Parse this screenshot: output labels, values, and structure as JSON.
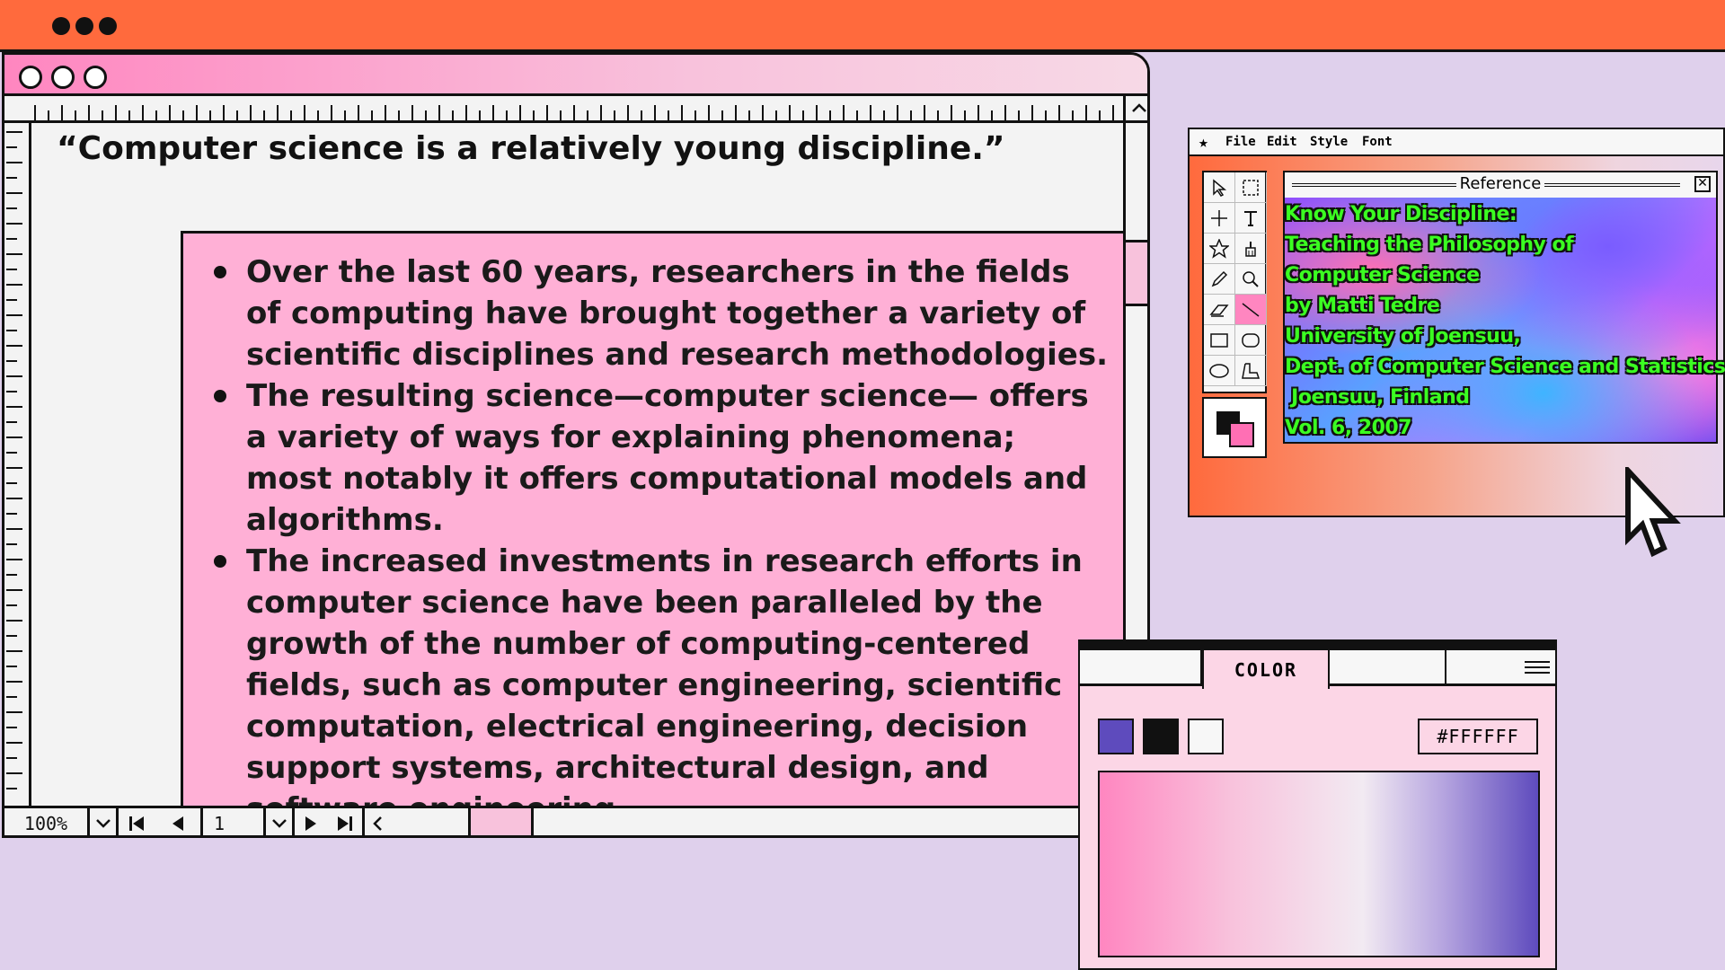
{
  "top_bar": {
    "dots": 3
  },
  "editor": {
    "quote": "“Computer science is a relatively young discipline.”",
    "bullets": [
      "Over the last 60 years, researchers in the fields of computing have brought together a variety of scientific disciplines and research methodologies.",
      "The resulting science—computer science— offers a variety of ways for explaining phenomena; most notably it offers computational models and algorithms.",
      "The increased investments in research efforts in computer science have been paralleled by the growth of the number of computing-centered fields, such as computer engineering, scientific computation, electrical engineering, decision support systems, architectural design, and software engineering."
    ],
    "status": {
      "zoom": "100%",
      "page": "1"
    }
  },
  "paint": {
    "menu": [
      "File",
      "Edit",
      "Style",
      "Font"
    ],
    "reference_title": "Reference",
    "reference_lines": [
      "Know Your Discipline:",
      "Teaching the Philosophy of",
      "Computer Science",
      "by Matti Tedre",
      "University of Joensuu,",
      "Dept. of Computer Science and Statistics",
      " Joensuu, Finland",
      "Vol. 6, 2007"
    ]
  },
  "color_panel": {
    "tab": "COLOR",
    "hex": "#FFFFFF",
    "swatches": [
      "#5e4bbd",
      "#111111",
      "#f7f7f7"
    ]
  },
  "colors": {
    "accent_orange": "#ff6a3d",
    "accent_pink": "#ff86c0",
    "lavender_bg": "#dfd0ec",
    "ref_text": "#3bff21"
  }
}
